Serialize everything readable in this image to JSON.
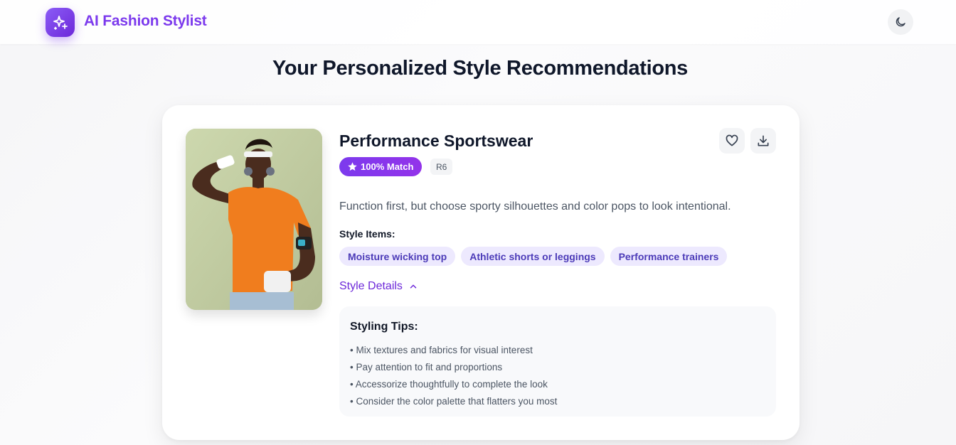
{
  "header": {
    "app_title": "AI Fashion Stylist",
    "logo_icon": "sparkles-icon",
    "theme_icon": "moon-icon"
  },
  "page": {
    "title": "Your Personalized Style Recommendations"
  },
  "recommendation": {
    "title": "Performance Sportswear",
    "match_label": "100% Match",
    "code": "R6",
    "description": "Function first, but choose sporty silhouettes and color pops to look intentional.",
    "items_label": "Style Items:",
    "items": [
      "Moisture wicking top",
      "Athletic shorts or leggings",
      "Performance trainers"
    ],
    "details_label": "Style Details",
    "tips_title": "Styling Tips:",
    "tips": [
      "• Mix textures and fabrics for visual interest",
      "• Pay attention to fit and proportions",
      "• Accessorize thoughtfully to complete the look",
      "• Consider the color palette that flatters you most"
    ]
  },
  "colors": {
    "brand": "#7c3aed",
    "tag_bg": "#ede9fe",
    "tag_text": "#4c3bb8",
    "shirt": "#f07d1e"
  }
}
